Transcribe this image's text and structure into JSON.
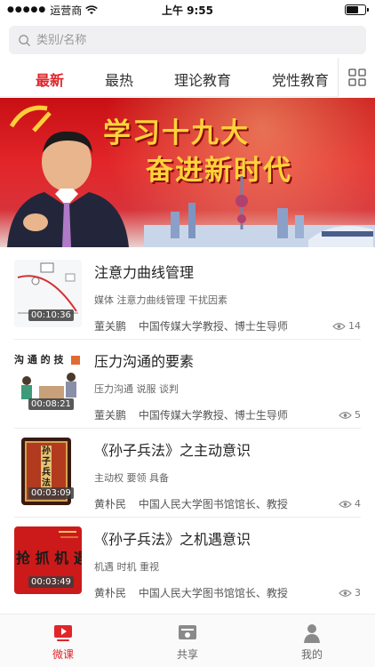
{
  "status_bar": {
    "carrier": "运营商",
    "time": "上午 9:55"
  },
  "search": {
    "placeholder": "类别/名称"
  },
  "tabs": [
    {
      "label": "最新",
      "active": true
    },
    {
      "label": "最热",
      "active": false
    },
    {
      "label": "理论教育",
      "active": false
    },
    {
      "label": "党性教育",
      "active": false
    }
  ],
  "banner": {
    "line1": "学习十九大",
    "line2": "奋进新时代"
  },
  "videos": [
    {
      "title": "注意力曲线管理",
      "tags": "媒体 注意力曲线管理 干扰因素",
      "author": "董关鹏",
      "author_title": "中国传媒大学教授、博士生导师",
      "duration": "00:10:36",
      "views": "14"
    },
    {
      "title": "压力沟通的要素",
      "tags": "压力沟通 说服 谈判",
      "author": "董关鹏",
      "author_title": "中国传媒大学教授、博士生导师",
      "duration": "00:08:21",
      "views": "5",
      "thumb_text": "沟 通 的 技"
    },
    {
      "title": "《孙子兵法》之主动意识",
      "tags": "主动权 要领 具备",
      "author": "黄朴民",
      "author_title": "中国人民大学图书馆馆长、教授",
      "duration": "00:03:09",
      "views": "4",
      "thumb_text": "孙子兵法"
    },
    {
      "title": "《孙子兵法》之机遇意识",
      "tags": "机遇 时机 重视",
      "author": "黄朴民",
      "author_title": "中国人民大学图书馆馆长、教授",
      "duration": "00:03:49",
      "views": "3",
      "thumb_text": "抢 抓 机 遇"
    }
  ],
  "tabbar": [
    {
      "label": "微课",
      "icon": "video-icon",
      "active": true
    },
    {
      "label": "共享",
      "icon": "share-icon",
      "active": false
    },
    {
      "label": "我的",
      "icon": "profile-icon",
      "active": false
    }
  ],
  "colors": {
    "accent": "#e0262b",
    "banner_red": "#d0141a",
    "banner_text": "#ffd33a"
  }
}
